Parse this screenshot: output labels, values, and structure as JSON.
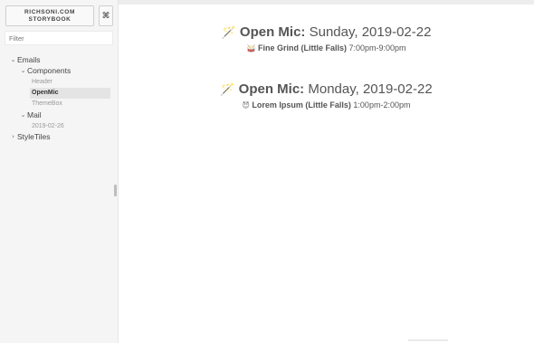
{
  "sidebar": {
    "brand_line1": "RICHSONI.COM",
    "brand_line2": "STORYBOOK",
    "shortcut_icon": "⌘",
    "filter_placeholder": "Filter",
    "tree": {
      "emails": {
        "label": "Emails",
        "expanded": true
      },
      "components": {
        "label": "Components",
        "expanded": true
      },
      "header": {
        "label": "Header"
      },
      "openmic": {
        "label": "OpenMic",
        "selected": true
      },
      "themebox": {
        "label": "ThemeBox"
      },
      "mail": {
        "label": "Mail",
        "expanded": true
      },
      "mail_date": {
        "label": "2019-02-26"
      },
      "styletiles": {
        "label": "StyleTiles",
        "expanded": false
      }
    }
  },
  "preview": {
    "events": [
      {
        "icon": "magic-wand-icon",
        "emoji": "🪄",
        "label": "Open Mic:",
        "date": "Sunday, 2019-02-22",
        "venue_icon": "drum-icon",
        "venue_emoji": "🥁",
        "venue": "Fine Grind (Little Falls)",
        "time": "7:00pm-9:00pm"
      },
      {
        "icon": "magic-wand-icon",
        "emoji": "🪄",
        "label": "Open Mic:",
        "date": "Monday, 2019-02-22",
        "venue_icon": "face-icon",
        "venue_emoji": "😈",
        "venue": "Lorem Ipsum (Little Falls)",
        "time": "1:00pm-2:00pm"
      }
    ]
  }
}
